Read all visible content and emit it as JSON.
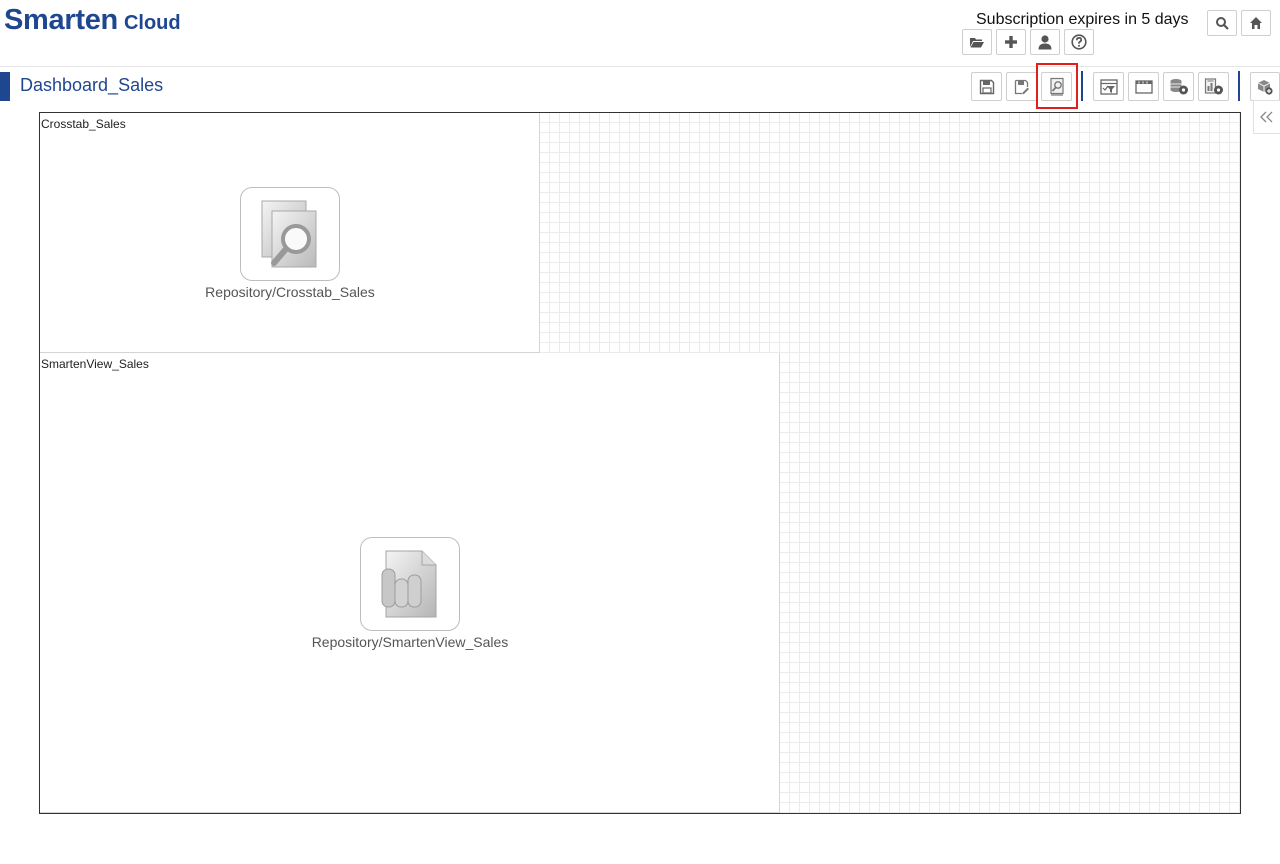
{
  "header": {
    "brand_main": "Smarten",
    "brand_sub": "Cloud",
    "subscription_text": "Subscription expires in 5 days",
    "brand_color": "#1f4690"
  },
  "page": {
    "title": "Dashboard_Sales"
  },
  "toolbar": {
    "highlight_color": "#e0201b",
    "icons": [
      "save-icon",
      "save-as-icon",
      "preview-icon",
      "filter-icon",
      "frame-icon",
      "database-settings-icon",
      "report-settings-icon",
      "cube-add-icon"
    ]
  },
  "canvas": {
    "widgets": [
      {
        "title": "Crosstab_Sales",
        "object_label": "Repository/Crosstab_Sales",
        "icon": "crosstab-search-icon"
      },
      {
        "title": "SmartenView_Sales",
        "object_label": "Repository/SmartenView_Sales",
        "icon": "smartenview-document-icon"
      }
    ]
  }
}
